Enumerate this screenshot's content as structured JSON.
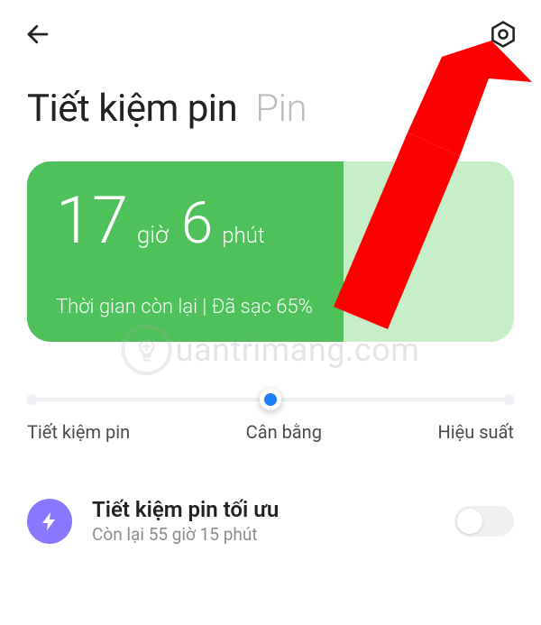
{
  "tabs": {
    "active": "Tiết kiệm pin",
    "inactive": "Pin"
  },
  "battery": {
    "hours": "17",
    "hours_unit": "giờ",
    "minutes": "6",
    "minutes_unit": "phút",
    "status": "Thời gian còn lại | Đã sạc 65%"
  },
  "slider": {
    "left": "Tiết kiệm pin",
    "mid": "Cân bằng",
    "right": "Hiệu suất"
  },
  "optimal": {
    "title": "Tiết kiệm pin tối ưu",
    "subtitle": "Còn lại 55 giờ 15 phút"
  },
  "watermark": "uantrimang.com"
}
